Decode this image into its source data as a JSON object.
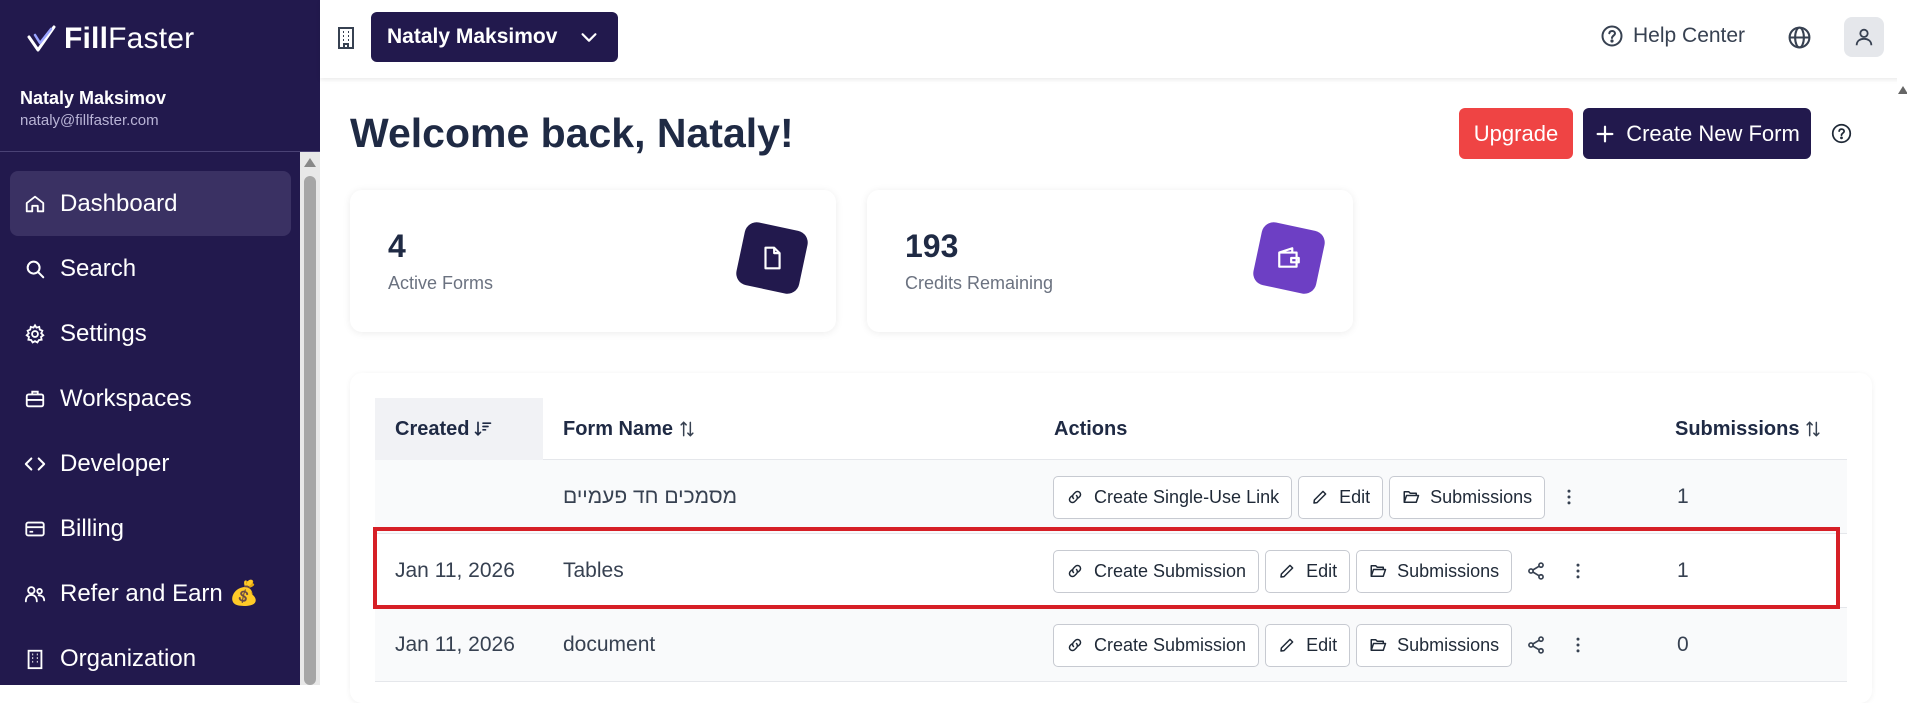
{
  "brand": {
    "name_bold": "Fill",
    "name_light": "Faster"
  },
  "user": {
    "name": "Nataly Maksimov",
    "email": "nataly@fillfaster.com"
  },
  "sidebar": {
    "items": [
      {
        "label": "Dashboard",
        "icon": "home-icon",
        "active": true
      },
      {
        "label": "Search",
        "icon": "search-icon"
      },
      {
        "label": "Settings",
        "icon": "gear-icon"
      },
      {
        "label": "Workspaces",
        "icon": "briefcase-icon"
      },
      {
        "label": "Developer",
        "icon": "code-icon"
      },
      {
        "label": "Billing",
        "icon": "credit-card-icon"
      },
      {
        "label": "Refer and Earn 💰",
        "icon": "handshake-icon"
      },
      {
        "label": "Organization",
        "icon": "building-icon"
      }
    ]
  },
  "header": {
    "account_selector": "Nataly Maksimov",
    "help_center": "Help Center"
  },
  "main": {
    "welcome": "Welcome back, Nataly!",
    "upgrade_label": "Upgrade",
    "create_form_label": "Create New Form",
    "stats": [
      {
        "value": "4",
        "label": "Active Forms",
        "icon": "file-icon",
        "color": "#22194d"
      },
      {
        "value": "193",
        "label": "Credits Remaining",
        "icon": "wallet-icon",
        "color": "#6d3fc4"
      }
    ]
  },
  "table": {
    "headers": {
      "created": "Created",
      "form_name": "Form Name",
      "actions": "Actions",
      "submissions": "Submissions"
    },
    "rows": [
      {
        "created": "",
        "form_name": "מסמכים חד פעמיים",
        "link_action": "Create Single-Use Link",
        "edit": "Edit",
        "submissions_btn": "Submissions",
        "submissions": "1",
        "shareable": false
      },
      {
        "created": "Jan 11, 2026",
        "form_name": "Tables",
        "link_action": "Create Submission",
        "edit": "Edit",
        "submissions_btn": "Submissions",
        "submissions": "1",
        "shareable": true
      },
      {
        "created": "Jan 11, 2026",
        "form_name": "document",
        "link_action": "Create Submission",
        "edit": "Edit",
        "submissions_btn": "Submissions",
        "submissions": "0",
        "shareable": true
      }
    ]
  },
  "colors": {
    "sidebar_bg": "#22194d",
    "accent": "#22194d",
    "upgrade": "#ef4444",
    "highlight": "#d61f26"
  }
}
